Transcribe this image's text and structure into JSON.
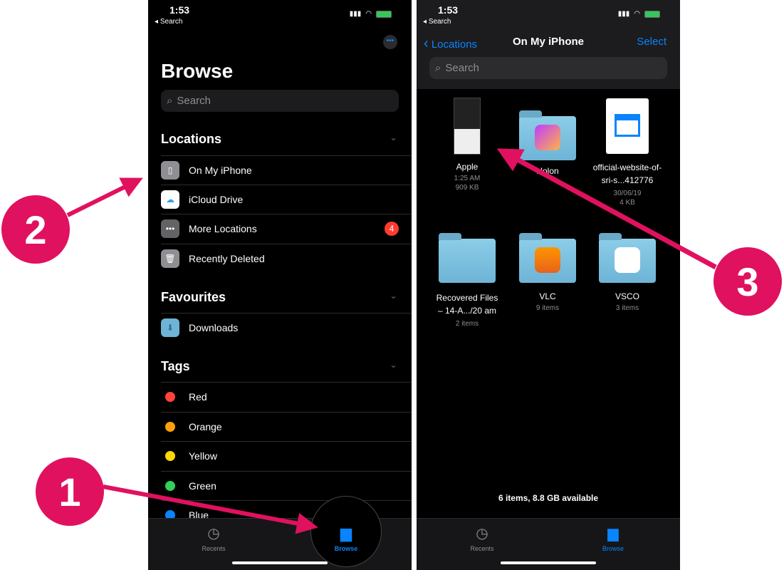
{
  "status": {
    "time": "1:53",
    "back": "Search"
  },
  "left": {
    "title": "Browse",
    "search_placeholder": "Search",
    "locations": {
      "title": "Locations",
      "items": [
        {
          "label": "On My iPhone"
        },
        {
          "label": "iCloud Drive"
        },
        {
          "label": "More Locations",
          "badge": "4"
        },
        {
          "label": "Recently Deleted"
        }
      ]
    },
    "favourites": {
      "title": "Favourites",
      "items": [
        {
          "label": "Downloads"
        }
      ]
    },
    "tags": {
      "title": "Tags",
      "items": [
        {
          "label": "Red",
          "color": "#ff453a"
        },
        {
          "label": "Orange",
          "color": "#ff9f0a"
        },
        {
          "label": "Yellow",
          "color": "#ffd60a"
        },
        {
          "label": "Green",
          "color": "#30d158"
        },
        {
          "label": "Blue",
          "color": "#0a84ff"
        }
      ]
    }
  },
  "right": {
    "back": "Locations",
    "title": "On My iPhone",
    "select": "Select",
    "search_placeholder": "Search",
    "items": [
      {
        "name": "Apple",
        "sub1": "1:25 AM",
        "sub2": "909 KB"
      },
      {
        "name": "Holon"
      },
      {
        "name": "official-website-of-sri-s...412776",
        "sub1": "30/06/19",
        "sub2": "4 KB"
      },
      {
        "name": "Recovered Files – 14-A.../20 am",
        "sub1": "2 items"
      },
      {
        "name": "VLC",
        "sub1": "9 items"
      },
      {
        "name": "VSCO",
        "sub1": "3 items"
      }
    ],
    "footer": "6 items, 8.8 GB available"
  },
  "tabs": {
    "recents": "Recents",
    "browse": "Browse"
  },
  "annotations": [
    "1",
    "2",
    "3"
  ],
  "accent": "#0a84ff",
  "annotation_color": "#e0115f"
}
